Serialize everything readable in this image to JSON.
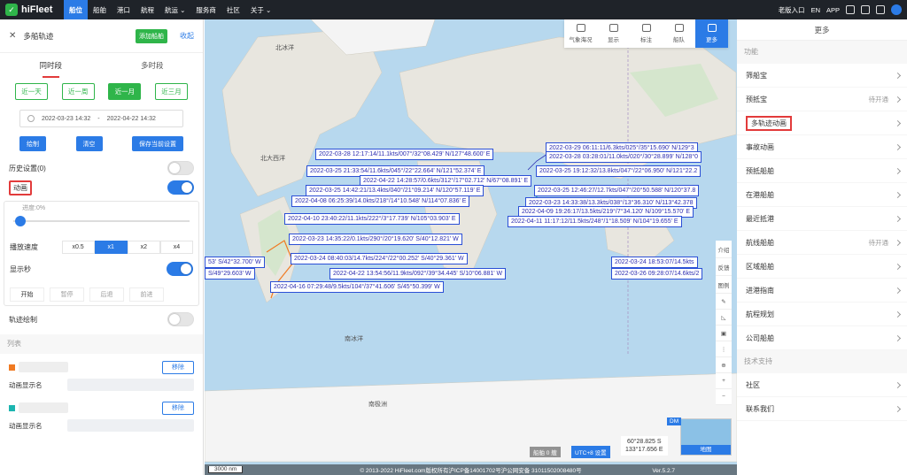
{
  "topbar": {
    "logo": "hiFleet",
    "nav": [
      "船位",
      "船舶",
      "港口",
      "航程",
      "航运",
      "服务商",
      "社区",
      "关于"
    ],
    "right": [
      "老版入口",
      "EN",
      "APP"
    ]
  },
  "left_panel": {
    "title": "多船轨迹",
    "add_ship": "添加船舶",
    "collapse": "收起",
    "tabs": [
      "同时段",
      "多时段"
    ],
    "ranges": [
      "近一天",
      "近一周",
      "近一月",
      "近三月"
    ],
    "date_start": "2022-03-23 14:32",
    "date_sep": "-",
    "date_end": "2022-04-22 14:32",
    "actions": [
      "绘制",
      "清空",
      "保存当前设置"
    ],
    "history": "历史设置(0)",
    "animation": "动画",
    "progress": "进度:0%",
    "progress_value": 0,
    "speed_label": "播放速度",
    "speeds": [
      "x0.5",
      "x1",
      "x2",
      "x4"
    ],
    "show_seconds": "显示秒",
    "controls": [
      "开始",
      "暂停",
      "后退",
      "前进"
    ],
    "track_draw": "轨迹绘制",
    "list_title": "列表",
    "ships": [
      {
        "color": "#f07a22",
        "remove": "移除",
        "name_label": "动画显示名"
      },
      {
        "color": "#1cb5b0",
        "remove": "移除",
        "name_label": "动画显示名"
      }
    ]
  },
  "map": {
    "toolbar": [
      "气象海况",
      "显示",
      "标注",
      "船队",
      "更多"
    ],
    "labels": [
      {
        "text": "北大西洋"
      },
      {
        "text": "南冰洋"
      },
      {
        "text": "南极洲"
      },
      {
        "text": "北冰洋"
      }
    ],
    "tracks": [
      "2022-03-29 06:11:11/6.3kts/025°/35°15.690' N/129°3",
      "2022-03-28 12:17:14/11.1kts/007°/32°08.429' N/127°48.600' E",
      "2022-03-28 03:28:01/11.0kts/020°/30°28.899' N/128°0",
      "2022-03-25 21:33:54/11.6kts/045°/22°22.664' N/121°52.374' E",
      "2022-03-25 19:12:32/13.8kts/047°/22°06.950' N/121°22.2",
      "2022-04-22 14:28:57/0.6kts/312°/17°02.712' N/67°08.891' E",
      "2022-03-25 14:42:21/13.4kts/040°/21°09.214' N/120°57.119' E",
      "2022-03-25 12:46:27/12.7kts/047°/20°50.588' N/120°37.8",
      "2022-04-08 06:25:39/14.0kts/218°/14°10.548' N/114°07.836' E",
      "2022-03-23 14:33:38/13.3kts/038°/13°36.310' N/113°42.378",
      "2022-04-09 19:26:17/13.5kts/219°/7°34.120' N/109°15.570' E",
      "2022-04-10 23:40:22/11.1kts/222°/3°17.739' N/105°03.903' E",
      "2022-04-11 11:17:12/11.5kts/248°/1°18.509' N/104°19.655' E",
      "2022-03-23 14:35:22/0.1kts/290°/20°19.620' S/40°12.821' W",
      "53' S/42°32.700' W",
      "2022-03-24 08:40:03/14.7kts/224°/22°00.252' S/40°29.361' W",
      "2022-03-24 18:53:07/14.5kts",
      "S/49°29.603' W",
      "2022-04-22 13:54:56/11.9kts/092°/39°34.445' S/10°06.881' W",
      "2022-03-26 09:28:07/14.6kts/2",
      "2022-04-16 07:29:48/9.5kts/104°/37°41.606' S/45°50.399' W"
    ],
    "side_tools": [
      "介绍",
      "反馈",
      "图例"
    ],
    "ship_count": "船舶 0 艘",
    "utc": "UTC+8 设置",
    "coord_lat": "60°28.825 S",
    "coord_lon": "133°17.656 E",
    "minimap_label": "地图",
    "minimap_tag": "DM",
    "scale": "3000 nm",
    "copyright": "© 2013-2022 HiFleet.com版权所有沪ICP备14001702号沪公网安备 31011502008480号",
    "version": "Ver.5.2.7"
  },
  "right_panel": {
    "title": "更多",
    "section_func": "功能",
    "items": [
      {
        "label": "筛船宝",
        "note": ""
      },
      {
        "label": "预抵宝",
        "note": "待开通"
      },
      {
        "label": "多轨迹动画",
        "note": ""
      },
      {
        "label": "事故动画",
        "note": ""
      },
      {
        "label": "预抵船舶",
        "note": ""
      },
      {
        "label": "在港船舶",
        "note": ""
      },
      {
        "label": "最近抵港",
        "note": ""
      },
      {
        "label": "航线船舶",
        "note": "待开通"
      },
      {
        "label": "区域船舶",
        "note": ""
      },
      {
        "label": "进港指南",
        "note": ""
      },
      {
        "label": "航程规划",
        "note": ""
      },
      {
        "label": "公司船舶",
        "note": ""
      }
    ],
    "section_support": "技术支持",
    "support_items": [
      {
        "label": "社区"
      },
      {
        "label": "联系我们"
      }
    ]
  },
  "colors": {
    "accent": "#2b7be6",
    "green": "#2fb54a",
    "highlight": "#e23b3b",
    "track": "#2c2cb0"
  }
}
